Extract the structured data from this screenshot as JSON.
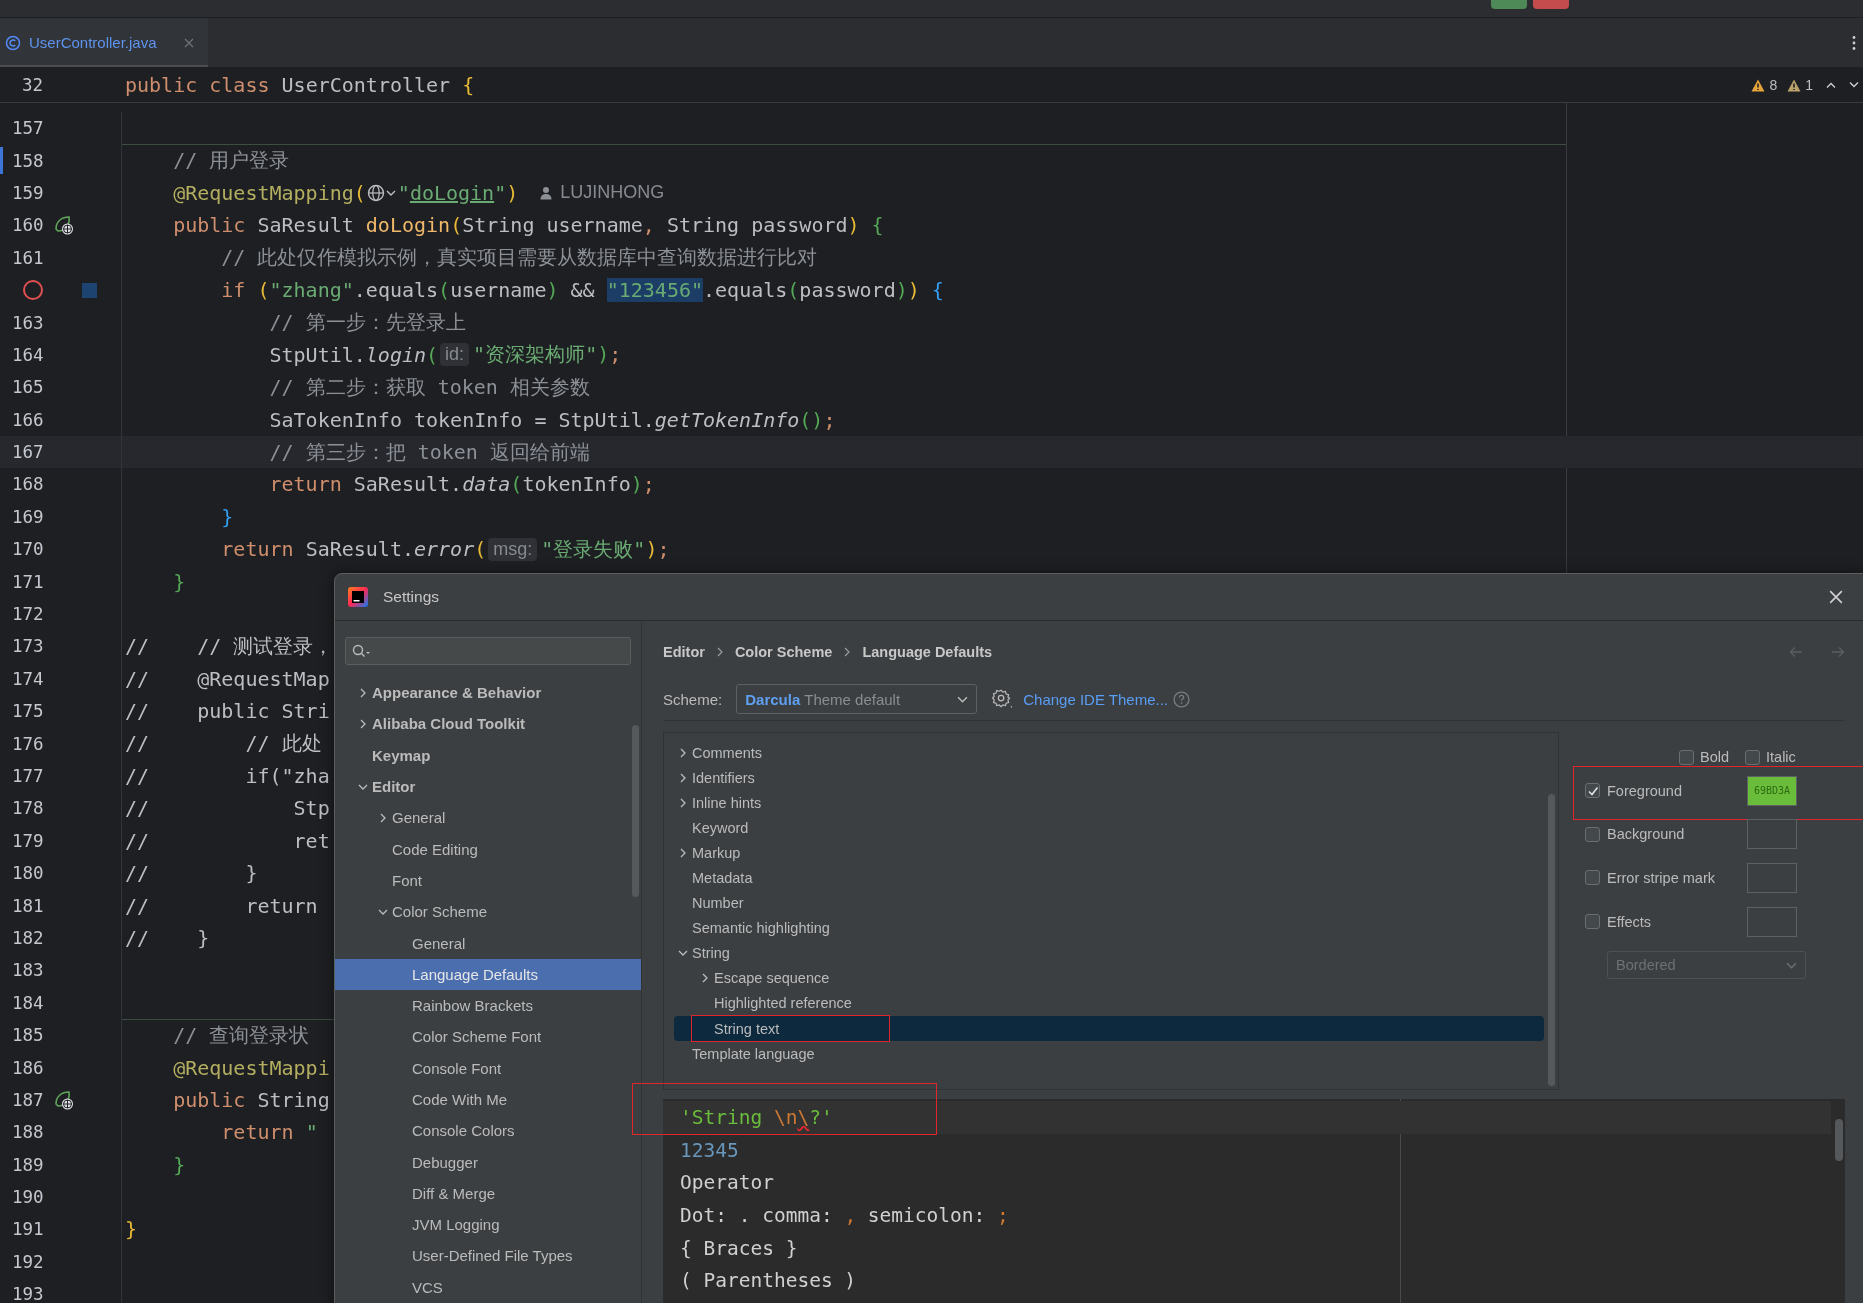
{
  "toolbar": {
    "buttons": [
      {
        "color": "#4e8a57"
      },
      {
        "color": "#c44c4c"
      }
    ]
  },
  "tabs": [
    {
      "label": "UserController.java",
      "selected": true
    }
  ],
  "editor": {
    "sticky_line": {
      "number": "32",
      "tokens": [
        {
          "kind": "kw",
          "text": "public class "
        },
        {
          "kind": "plain",
          "text": "UserController "
        },
        {
          "kind": "b1",
          "text": "{"
        }
      ]
    },
    "inspections": [
      {
        "kind": "warning",
        "count": "8"
      },
      {
        "kind": "weak_warning",
        "count": "1"
      }
    ],
    "lines": [
      {
        "number": "157"
      },
      {
        "number": "158",
        "method_separator": true,
        "changed": true,
        "tokens": [
          {
            "kind": "cmt",
            "text": "    // 用户登录"
          }
        ]
      },
      {
        "number": "159",
        "tokens": [
          {
            "kind": "ann",
            "text": "    @RequestMapping"
          },
          {
            "kind": "b1",
            "text": "("
          },
          {
            "kind": "globe"
          },
          {
            "kind": "str",
            "text": "\""
          },
          {
            "kind": "link",
            "text": "doLogin"
          },
          {
            "kind": "str",
            "text": "\""
          },
          {
            "kind": "b1",
            "text": ")"
          },
          {
            "kind": "author",
            "text": "LUJINHONG"
          }
        ]
      },
      {
        "number": "160",
        "gutter": {
          "kind": "endpoint"
        },
        "tokens": [
          {
            "kind": "kw",
            "text": "    public "
          },
          {
            "kind": "plain",
            "text": "SaResult "
          },
          {
            "kind": "fn",
            "text": "doLogin"
          },
          {
            "kind": "b1",
            "text": "("
          },
          {
            "kind": "plain",
            "text": "String username"
          },
          {
            "kind": "kw",
            "text": ", "
          },
          {
            "kind": "plain",
            "text": "String password"
          },
          {
            "kind": "b1",
            "text": ") "
          },
          {
            "kind": "b2",
            "text": "{"
          }
        ]
      },
      {
        "number": "161",
        "tokens": [
          {
            "kind": "cmt",
            "text": "        // 此处仅作模拟示例，真实项目需要从数据库中查询数据进行比对"
          }
        ]
      },
      {
        "gutter": {
          "kind": "breakpoint"
        },
        "tokens": [
          {
            "kind": "kw",
            "text": "        if "
          },
          {
            "kind": "b1",
            "text": "("
          },
          {
            "kind": "str",
            "text": "\"zhang\""
          },
          {
            "kind": "plain",
            "text": ".equals"
          },
          {
            "kind": "b2",
            "text": "("
          },
          {
            "kind": "plain",
            "text": "username"
          },
          {
            "kind": "b2",
            "text": ")"
          },
          {
            "kind": "plain",
            "text": " && "
          },
          {
            "kind": "sel",
            "text": "\"123456\""
          },
          {
            "kind": "plain",
            "text": ".equals"
          },
          {
            "kind": "b2",
            "text": "("
          },
          {
            "kind": "plain",
            "text": "password"
          },
          {
            "kind": "b2",
            "text": ")"
          },
          {
            "kind": "b1",
            "text": ") "
          },
          {
            "kind": "b3",
            "text": "{"
          }
        ]
      },
      {
        "number": "163",
        "tokens": [
          {
            "kind": "cmt",
            "text": "            // 第一步：先登录上"
          }
        ]
      },
      {
        "number": "164",
        "tokens": [
          {
            "kind": "plain",
            "text": "            StpUtil."
          },
          {
            "kind": "call",
            "text": "login"
          },
          {
            "kind": "b2",
            "text": "("
          },
          {
            "kind": "hint",
            "text": "id:"
          },
          {
            "kind": "str",
            "text": "\"资深架构师\""
          },
          {
            "kind": "b2",
            "text": ")"
          },
          {
            "kind": "kw",
            "text": ";"
          }
        ]
      },
      {
        "number": "165",
        "tokens": [
          {
            "kind": "cmt",
            "text": "            // 第二步：获取 token 相关参数"
          }
        ]
      },
      {
        "number": "166",
        "tokens": [
          {
            "kind": "plain",
            "text": "            SaTokenInfo tokenInfo = StpUtil."
          },
          {
            "kind": "call",
            "text": "getTokenInfo"
          },
          {
            "kind": "b2",
            "text": "()"
          },
          {
            "kind": "kw",
            "text": ";"
          }
        ]
      },
      {
        "number": "167",
        "current": true,
        "tokens": [
          {
            "kind": "cmt",
            "text": "            // 第三步：把 token 返回给前端"
          }
        ]
      },
      {
        "number": "168",
        "tokens": [
          {
            "kind": "kw",
            "text": "            return "
          },
          {
            "kind": "plain",
            "text": "SaResult."
          },
          {
            "kind": "call",
            "text": "data"
          },
          {
            "kind": "b2",
            "text": "("
          },
          {
            "kind": "plain",
            "text": "tokenInfo"
          },
          {
            "kind": "b2",
            "text": ")"
          },
          {
            "kind": "kw",
            "text": ";"
          }
        ]
      },
      {
        "number": "169",
        "tokens": [
          {
            "kind": "b3",
            "text": "        }"
          }
        ]
      },
      {
        "number": "170",
        "tokens": [
          {
            "kind": "kw",
            "text": "        return "
          },
          {
            "kind": "plain",
            "text": "SaResult."
          },
          {
            "kind": "call",
            "text": "error"
          },
          {
            "kind": "b1",
            "text": "("
          },
          {
            "kind": "hint",
            "text": "msg:"
          },
          {
            "kind": "str",
            "text": "\"登录失败\""
          },
          {
            "kind": "b1",
            "text": ")"
          },
          {
            "kind": "kw",
            "text": ";"
          }
        ]
      },
      {
        "number": "171",
        "tokens": [
          {
            "kind": "b2",
            "text": "    }"
          }
        ]
      },
      {
        "number": "172"
      },
      {
        "number": "173",
        "tokens": [
          {
            "kind": "plain",
            "text": "//    // 测试登录，"
          }
        ]
      },
      {
        "number": "174",
        "tokens": [
          {
            "kind": "plain",
            "text": "//    @RequestMap"
          }
        ]
      },
      {
        "number": "175",
        "tokens": [
          {
            "kind": "plain",
            "text": "//    public Stri"
          }
        ]
      },
      {
        "number": "176",
        "tokens": [
          {
            "kind": "plain",
            "text": "//        // 此处"
          }
        ]
      },
      {
        "number": "177",
        "tokens": [
          {
            "kind": "plain",
            "text": "//        if(\"zha"
          }
        ]
      },
      {
        "number": "178",
        "tokens": [
          {
            "kind": "plain",
            "text": "//            Stp"
          }
        ]
      },
      {
        "number": "179",
        "tokens": [
          {
            "kind": "plain",
            "text": "//            ret"
          }
        ]
      },
      {
        "number": "180",
        "tokens": [
          {
            "kind": "plain",
            "text": "//        }"
          }
        ]
      },
      {
        "number": "181",
        "tokens": [
          {
            "kind": "plain",
            "text": "//        return"
          }
        ]
      },
      {
        "number": "182",
        "tokens": [
          {
            "kind": "plain",
            "text": "//    }"
          }
        ]
      },
      {
        "number": "183"
      },
      {
        "number": "184"
      },
      {
        "number": "185",
        "method_separator": true,
        "tokens": [
          {
            "kind": "cmt",
            "text": "    // 查询登录状"
          }
        ]
      },
      {
        "number": "186",
        "tokens": [
          {
            "kind": "ann",
            "text": "    @RequestMappi"
          }
        ]
      },
      {
        "number": "187",
        "gutter": {
          "kind": "endpoint"
        },
        "tokens": [
          {
            "kind": "kw",
            "text": "    public "
          },
          {
            "kind": "plain",
            "text": "String"
          }
        ]
      },
      {
        "number": "188",
        "tokens": [
          {
            "kind": "kw",
            "text": "        return "
          },
          {
            "kind": "str",
            "text": "\""
          }
        ]
      },
      {
        "number": "189",
        "tokens": [
          {
            "kind": "b2",
            "text": "    }"
          }
        ]
      },
      {
        "number": "190"
      },
      {
        "number": "191",
        "tokens": [
          {
            "kind": "b1",
            "text": "}"
          }
        ]
      },
      {
        "number": "192"
      },
      {
        "number": "193"
      }
    ]
  },
  "settings": {
    "title": "Settings",
    "tree": [
      {
        "label": "Appearance & Behavior",
        "expanded": false,
        "selected": false
      },
      {
        "label": "Alibaba Cloud Toolkit",
        "expanded": false,
        "selected": false
      },
      {
        "label": "Keymap",
        "selected": false
      },
      {
        "label": "Editor",
        "expanded": true,
        "selected": false,
        "children": [
          {
            "label": "General",
            "expanded": false,
            "selected": false
          },
          {
            "label": "Code Editing",
            "selected": false
          },
          {
            "label": "Font",
            "selected": false
          },
          {
            "label": "Color Scheme",
            "expanded": true,
            "selected": false,
            "children": [
              {
                "label": "General",
                "selected": false
              },
              {
                "label": "Language Defaults",
                "selected": true
              },
              {
                "label": "Rainbow Brackets",
                "selected": false
              },
              {
                "label": "Color Scheme Font",
                "selected": false
              },
              {
                "label": "Console Font",
                "selected": false
              },
              {
                "label": "Code With Me",
                "selected": false
              },
              {
                "label": "Console Colors",
                "selected": false
              },
              {
                "label": "Debugger",
                "selected": false
              },
              {
                "label": "Diff & Merge",
                "selected": false
              },
              {
                "label": "JVM Logging",
                "selected": false
              },
              {
                "label": "User-Defined File Types",
                "selected": false
              },
              {
                "label": "VCS",
                "selected": false
              }
            ]
          }
        ]
      }
    ],
    "breadcrumb": [
      "Editor",
      "Color Scheme",
      "Language Defaults"
    ],
    "scheme": {
      "label": "Scheme:",
      "name": "Darcula",
      "detail": "Theme default"
    },
    "change_theme_link": "Change IDE Theme...",
    "attributes": [
      {
        "label": "Comments",
        "expanded": false,
        "selected": false
      },
      {
        "label": "Identifiers",
        "expanded": false,
        "selected": false
      },
      {
        "label": "Inline hints",
        "expanded": false,
        "selected": false
      },
      {
        "label": "Keyword",
        "selected": false
      },
      {
        "label": "Markup",
        "expanded": false,
        "selected": false
      },
      {
        "label": "Metadata",
        "selected": false
      },
      {
        "label": "Number",
        "selected": false
      },
      {
        "label": "Semantic highlighting",
        "selected": false
      },
      {
        "label": "String",
        "expanded": true,
        "selected": false,
        "children": [
          {
            "label": "Escape sequence",
            "expanded": false,
            "selected": false
          },
          {
            "label": "Highlighted reference",
            "selected": false
          },
          {
            "label": "String text",
            "selected": true,
            "framed": true
          }
        ]
      },
      {
        "label": "Template language",
        "selected": false
      }
    ],
    "font_styles": [
      {
        "label": "Bold",
        "checked": false
      },
      {
        "label": "Italic",
        "checked": false
      }
    ],
    "colors": [
      {
        "label": "Foreground",
        "checked": true,
        "framed": true,
        "value": "69BD3A",
        "color": "#69bd3a"
      },
      {
        "label": "Background",
        "checked": false
      },
      {
        "label": "Error stripe mark",
        "checked": false
      },
      {
        "label": "Effects",
        "checked": false
      }
    ],
    "effect_style": {
      "value": "Bordered",
      "disabled": true
    },
    "preview": [
      {
        "current": true,
        "framed": true,
        "tokens": [
          {
            "kind": "str",
            "text": "'String "
          },
          {
            "kind": "esc",
            "text": "\\n"
          },
          {
            "kind": "err",
            "text": "\\"
          },
          {
            "kind": "str",
            "text": "?'"
          }
        ]
      },
      {
        "tokens": [
          {
            "kind": "num",
            "text": "12345"
          }
        ]
      },
      {
        "tokens": [
          {
            "kind": "plain",
            "text": "Operator"
          }
        ]
      },
      {
        "tokens": [
          {
            "kind": "plain",
            "text": "Dot: . comma: "
          },
          {
            "kind": "kw",
            "text": ","
          },
          {
            "kind": "plain",
            "text": " semicolon: "
          },
          {
            "kind": "kw",
            "text": ";"
          }
        ]
      },
      {
        "tokens": [
          {
            "kind": "plain",
            "text": "{ Braces }"
          }
        ]
      },
      {
        "tokens": [
          {
            "kind": "plain",
            "text": "( Parentheses )"
          }
        ]
      }
    ]
  }
}
